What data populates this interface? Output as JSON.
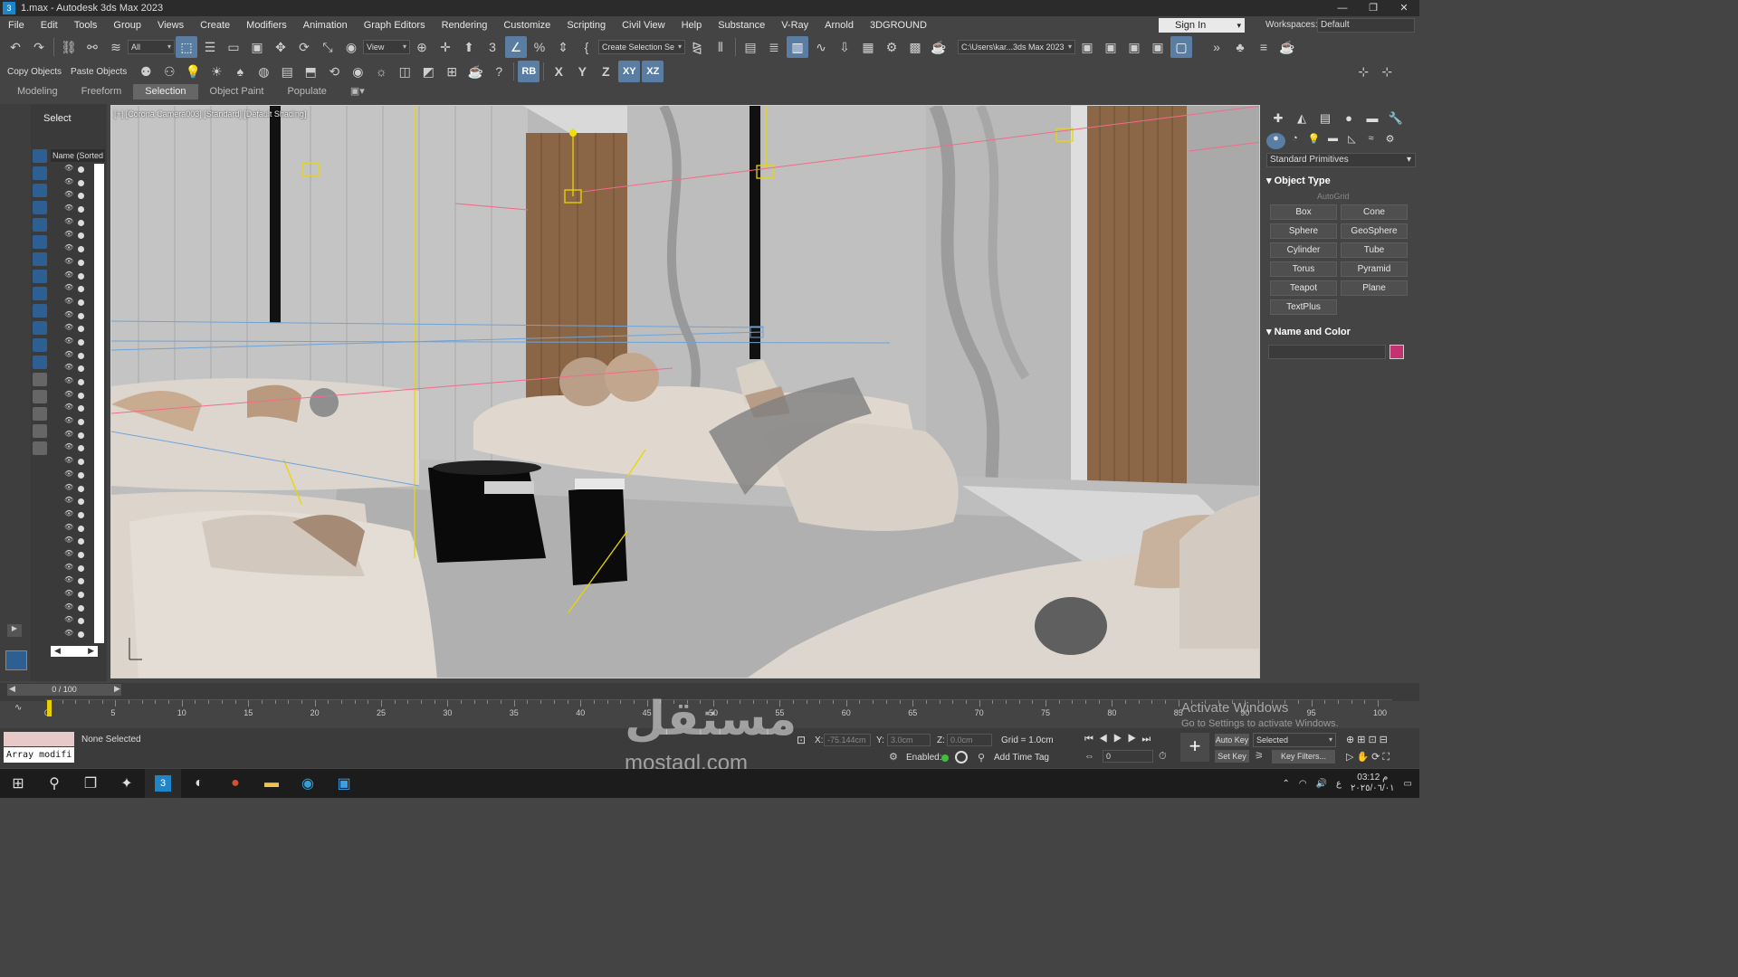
{
  "window": {
    "title": "1.max - Autodesk 3ds Max 2023"
  },
  "menu": [
    "File",
    "Edit",
    "Tools",
    "Group",
    "Views",
    "Create",
    "Modifiers",
    "Animation",
    "Graph Editors",
    "Rendering",
    "Customize",
    "Scripting",
    "Civil View",
    "Help",
    "Substance",
    "V-Ray",
    "Arnold",
    "3DGROUND"
  ],
  "signin": "Sign In",
  "workspaces": {
    "label": "Workspaces:",
    "value": "Default"
  },
  "toolbar": {
    "filter": "All",
    "ref_coord": "View",
    "selection_set": "Create Selection Se",
    "project_path": "C:\\Users\\kar...3ds Max 2023"
  },
  "toolbar2": {
    "copy": "Copy Objects",
    "paste": "Paste Objects",
    "rb": "RB",
    "x": "X",
    "y": "Y",
    "z": "Z",
    "xy": "XY",
    "xz": "XZ"
  },
  "ribbon_tabs": [
    "Modeling",
    "Freeform",
    "Selection",
    "Object Paint",
    "Populate"
  ],
  "explorer": {
    "title": "Select",
    "column": "Name (Sorted A"
  },
  "viewport": {
    "label": "[+] [Corona Camera003] [Standard] [Default Shading]"
  },
  "command_panel": {
    "category": "Standard Primitives",
    "object_type": "Object Type",
    "autogrid": "AutoGrid",
    "primitives": [
      "Box",
      "Cone",
      "Sphere",
      "GeoSphere",
      "Cylinder",
      "Tube",
      "Torus",
      "Pyramid",
      "Teapot",
      "Plane",
      "TextPlus"
    ],
    "name_and_color": "Name and Color",
    "color": "#c2336f"
  },
  "timeline": {
    "frame": "0 / 100",
    "ticks": [
      "0",
      "5",
      "10",
      "15",
      "20",
      "25",
      "30",
      "35",
      "40",
      "45",
      "50",
      "55",
      "60",
      "65",
      "70",
      "75",
      "80",
      "85",
      "90",
      "95",
      "100"
    ]
  },
  "status": {
    "maxscript": "Array modifi",
    "selection": "None Selected",
    "x_label": "X:",
    "x": "-75.144cm",
    "y_label": "Y:",
    "y": "3.0cm",
    "z_label": "Z:",
    "z": "0.0cm",
    "grid": "Grid = 1.0cm",
    "enabled": "Enabled:",
    "add_time_tag": "Add Time Tag",
    "auto_key": "Auto Key",
    "set_key": "Set Key",
    "key_mode": "Selected",
    "key_filters": "Key Filters...",
    "frame_field": "0"
  },
  "activation": {
    "title": "Activate Windows",
    "subtitle": "Go to Settings to activate Windows."
  },
  "watermark": {
    "arabic": "مستقل",
    "latin": "mostaql.com"
  },
  "taskbar": {
    "time": "03:12 م",
    "date": "٢٠٢٥/٠٦/٠١",
    "lang": "ع"
  }
}
